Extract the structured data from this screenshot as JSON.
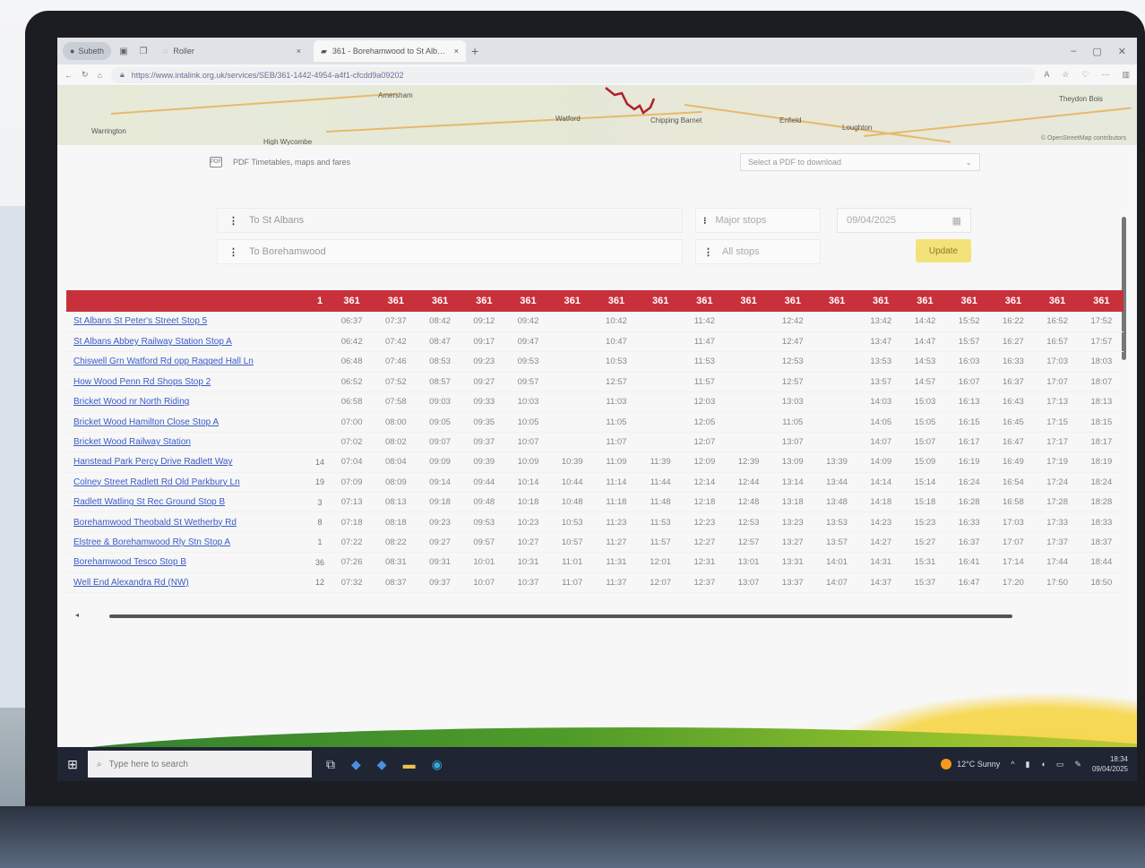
{
  "browser": {
    "profile_label": "Subeth",
    "tabs": [
      {
        "title": "Roller"
      },
      {
        "title": "361 - Borehamwood to St Albans"
      }
    ],
    "url": "https://www.intalink.org.uk/services/SEB/361-1442-4954-a4f1-cfcdd9a09202"
  },
  "map": {
    "places": [
      "Amersham",
      "Watford",
      "Chipping Barnet",
      "Enfield",
      "Loughton",
      "Warrington",
      "High Wycombe",
      "Theydon Bois"
    ],
    "credit": "© OpenStreetMap contributors"
  },
  "pdf": {
    "label": "PDF Timetables, maps and fares",
    "select_placeholder": "Select a PDF to download"
  },
  "directions": {
    "selected": "To St Albans",
    "other": "To Borehamwood"
  },
  "stop_filter": {
    "selected": "Major stops",
    "other": "All stops"
  },
  "date_value": "09/04/2025",
  "update_label": "Update",
  "timetable": {
    "code_header": "1",
    "headers": [
      "361",
      "361",
      "361",
      "361",
      "361",
      "361",
      "361",
      "361",
      "361",
      "361",
      "361",
      "361",
      "361",
      "361",
      "361",
      "361",
      "361",
      "361"
    ],
    "rows": [
      {
        "stop": "St Albans St Peter's Street Stop 5",
        "code": "",
        "times": [
          "06:37",
          "07:37",
          "08:42",
          "09:12",
          "09:42",
          "",
          "10:42",
          "",
          "11:42",
          "",
          "12:42",
          "",
          "13:42",
          "14:42",
          "15:52",
          "16:22",
          "16:52",
          "17:52"
        ]
      },
      {
        "stop": "St Albans Abbey Railway Station Stop A",
        "code": "",
        "times": [
          "06:42",
          "07:42",
          "08:47",
          "09:17",
          "09:47",
          "",
          "10:47",
          "",
          "11:47",
          "",
          "12:47",
          "",
          "13:47",
          "14:47",
          "15:57",
          "16:27",
          "16:57",
          "17:57"
        ]
      },
      {
        "stop": "Chiswell Grn Watford Rd opp Ragged Hall Ln",
        "code": "",
        "times": [
          "06:48",
          "07:46",
          "08:53",
          "09:23",
          "09:53",
          "",
          "10:53",
          "",
          "11:53",
          "",
          "12:53",
          "",
          "13:53",
          "14:53",
          "16:03",
          "16:33",
          "17:03",
          "18:03"
        ]
      },
      {
        "stop": "How Wood Penn Rd Shops Stop 2",
        "code": "",
        "times": [
          "06:52",
          "07:52",
          "08:57",
          "09:27",
          "09:57",
          "",
          "12:57",
          "",
          "11:57",
          "",
          "12:57",
          "",
          "13:57",
          "14:57",
          "16:07",
          "16:37",
          "17:07",
          "18:07"
        ]
      },
      {
        "stop": "Bricket Wood nr North Riding",
        "code": "",
        "times": [
          "06:58",
          "07:58",
          "09:03",
          "09:33",
          "10:03",
          "",
          "11:03",
          "",
          "12:03",
          "",
          "13:03",
          "",
          "14:03",
          "15:03",
          "16:13",
          "16:43",
          "17:13",
          "18:13"
        ]
      },
      {
        "stop": "Bricket Wood Hamilton Close Stop A",
        "code": "",
        "times": [
          "07:00",
          "08:00",
          "09:05",
          "09:35",
          "10:05",
          "",
          "11:05",
          "",
          "12:05",
          "",
          "11:05",
          "",
          "14:05",
          "15:05",
          "16:15",
          "16:45",
          "17:15",
          "18:15"
        ]
      },
      {
        "stop": "Bricket Wood Railway Station",
        "code": "",
        "times": [
          "07:02",
          "08:02",
          "09:07",
          "09:37",
          "10:07",
          "",
          "11:07",
          "",
          "12:07",
          "",
          "13:07",
          "",
          "14:07",
          "15:07",
          "16:17",
          "16:47",
          "17:17",
          "18:17"
        ]
      },
      {
        "stop": "Hanstead Park Percy Drive Radlett Way",
        "code": "14",
        "times": [
          "07:04",
          "08:04",
          "09:09",
          "09:39",
          "10:09",
          "10:39",
          "11:09",
          "11:39",
          "12:09",
          "12:39",
          "13:09",
          "13:39",
          "14:09",
          "15:09",
          "16:19",
          "16:49",
          "17:19",
          "18:19"
        ]
      },
      {
        "stop": "Colney Street Radlett Rd Old Parkbury Ln",
        "code": "19",
        "times": [
          "07:09",
          "08:09",
          "09:14",
          "09:44",
          "10:14",
          "10:44",
          "11:14",
          "11:44",
          "12:14",
          "12:44",
          "13:14",
          "13:44",
          "14:14",
          "15:14",
          "16:24",
          "16:54",
          "17:24",
          "18:24"
        ]
      },
      {
        "stop": "Radlett Watling St Rec Ground Stop B",
        "code": "3",
        "times": [
          "07:13",
          "08:13",
          "09:18",
          "09:48",
          "10:18",
          "10:48",
          "11:18",
          "11:48",
          "12:18",
          "12:48",
          "13:18",
          "13:48",
          "14:18",
          "15:18",
          "16:28",
          "16:58",
          "17:28",
          "18:28"
        ]
      },
      {
        "stop": "Borehamwood Theobald St Wetherby Rd",
        "code": "8",
        "times": [
          "07:18",
          "08:18",
          "09:23",
          "09:53",
          "10:23",
          "10:53",
          "11:23",
          "11:53",
          "12:23",
          "12:53",
          "13:23",
          "13:53",
          "14:23",
          "15:23",
          "16:33",
          "17:03",
          "17:33",
          "18:33"
        ]
      },
      {
        "stop": "Elstree & Borehamwood Rly Stn Stop A",
        "code": "1",
        "times": [
          "07:22",
          "08:22",
          "09:27",
          "09:57",
          "10:27",
          "10:57",
          "11:27",
          "11:57",
          "12:27",
          "12:57",
          "13:27",
          "13:57",
          "14:27",
          "15:27",
          "16:37",
          "17:07",
          "17:37",
          "18:37"
        ]
      },
      {
        "stop": "Borehamwood Tesco Stop B",
        "code": "36",
        "times": [
          "07:26",
          "08:31",
          "09:31",
          "10:01",
          "10:31",
          "11:01",
          "11:31",
          "12:01",
          "12:31",
          "13:01",
          "13:31",
          "14:01",
          "14:31",
          "15:31",
          "16:41",
          "17:14",
          "17:44",
          "18:44"
        ]
      },
      {
        "stop": "Well End Alexandra Rd (NW)",
        "code": "12",
        "times": [
          "07:32",
          "08:37",
          "09:37",
          "10:07",
          "10:37",
          "11:07",
          "11:37",
          "12:07",
          "12:37",
          "13:07",
          "13:37",
          "14:07",
          "14:37",
          "15:37",
          "16:47",
          "17:20",
          "17:50",
          "18:50"
        ]
      }
    ]
  },
  "taskbar": {
    "search_placeholder": "Type here to search",
    "weather": "12°C Sunny",
    "time": "18:34",
    "date": "09/04/2025"
  },
  "colors": {
    "header_red": "#c8303b",
    "link_blue": "#3a5bc7",
    "update_yellow": "#f3e27a"
  }
}
